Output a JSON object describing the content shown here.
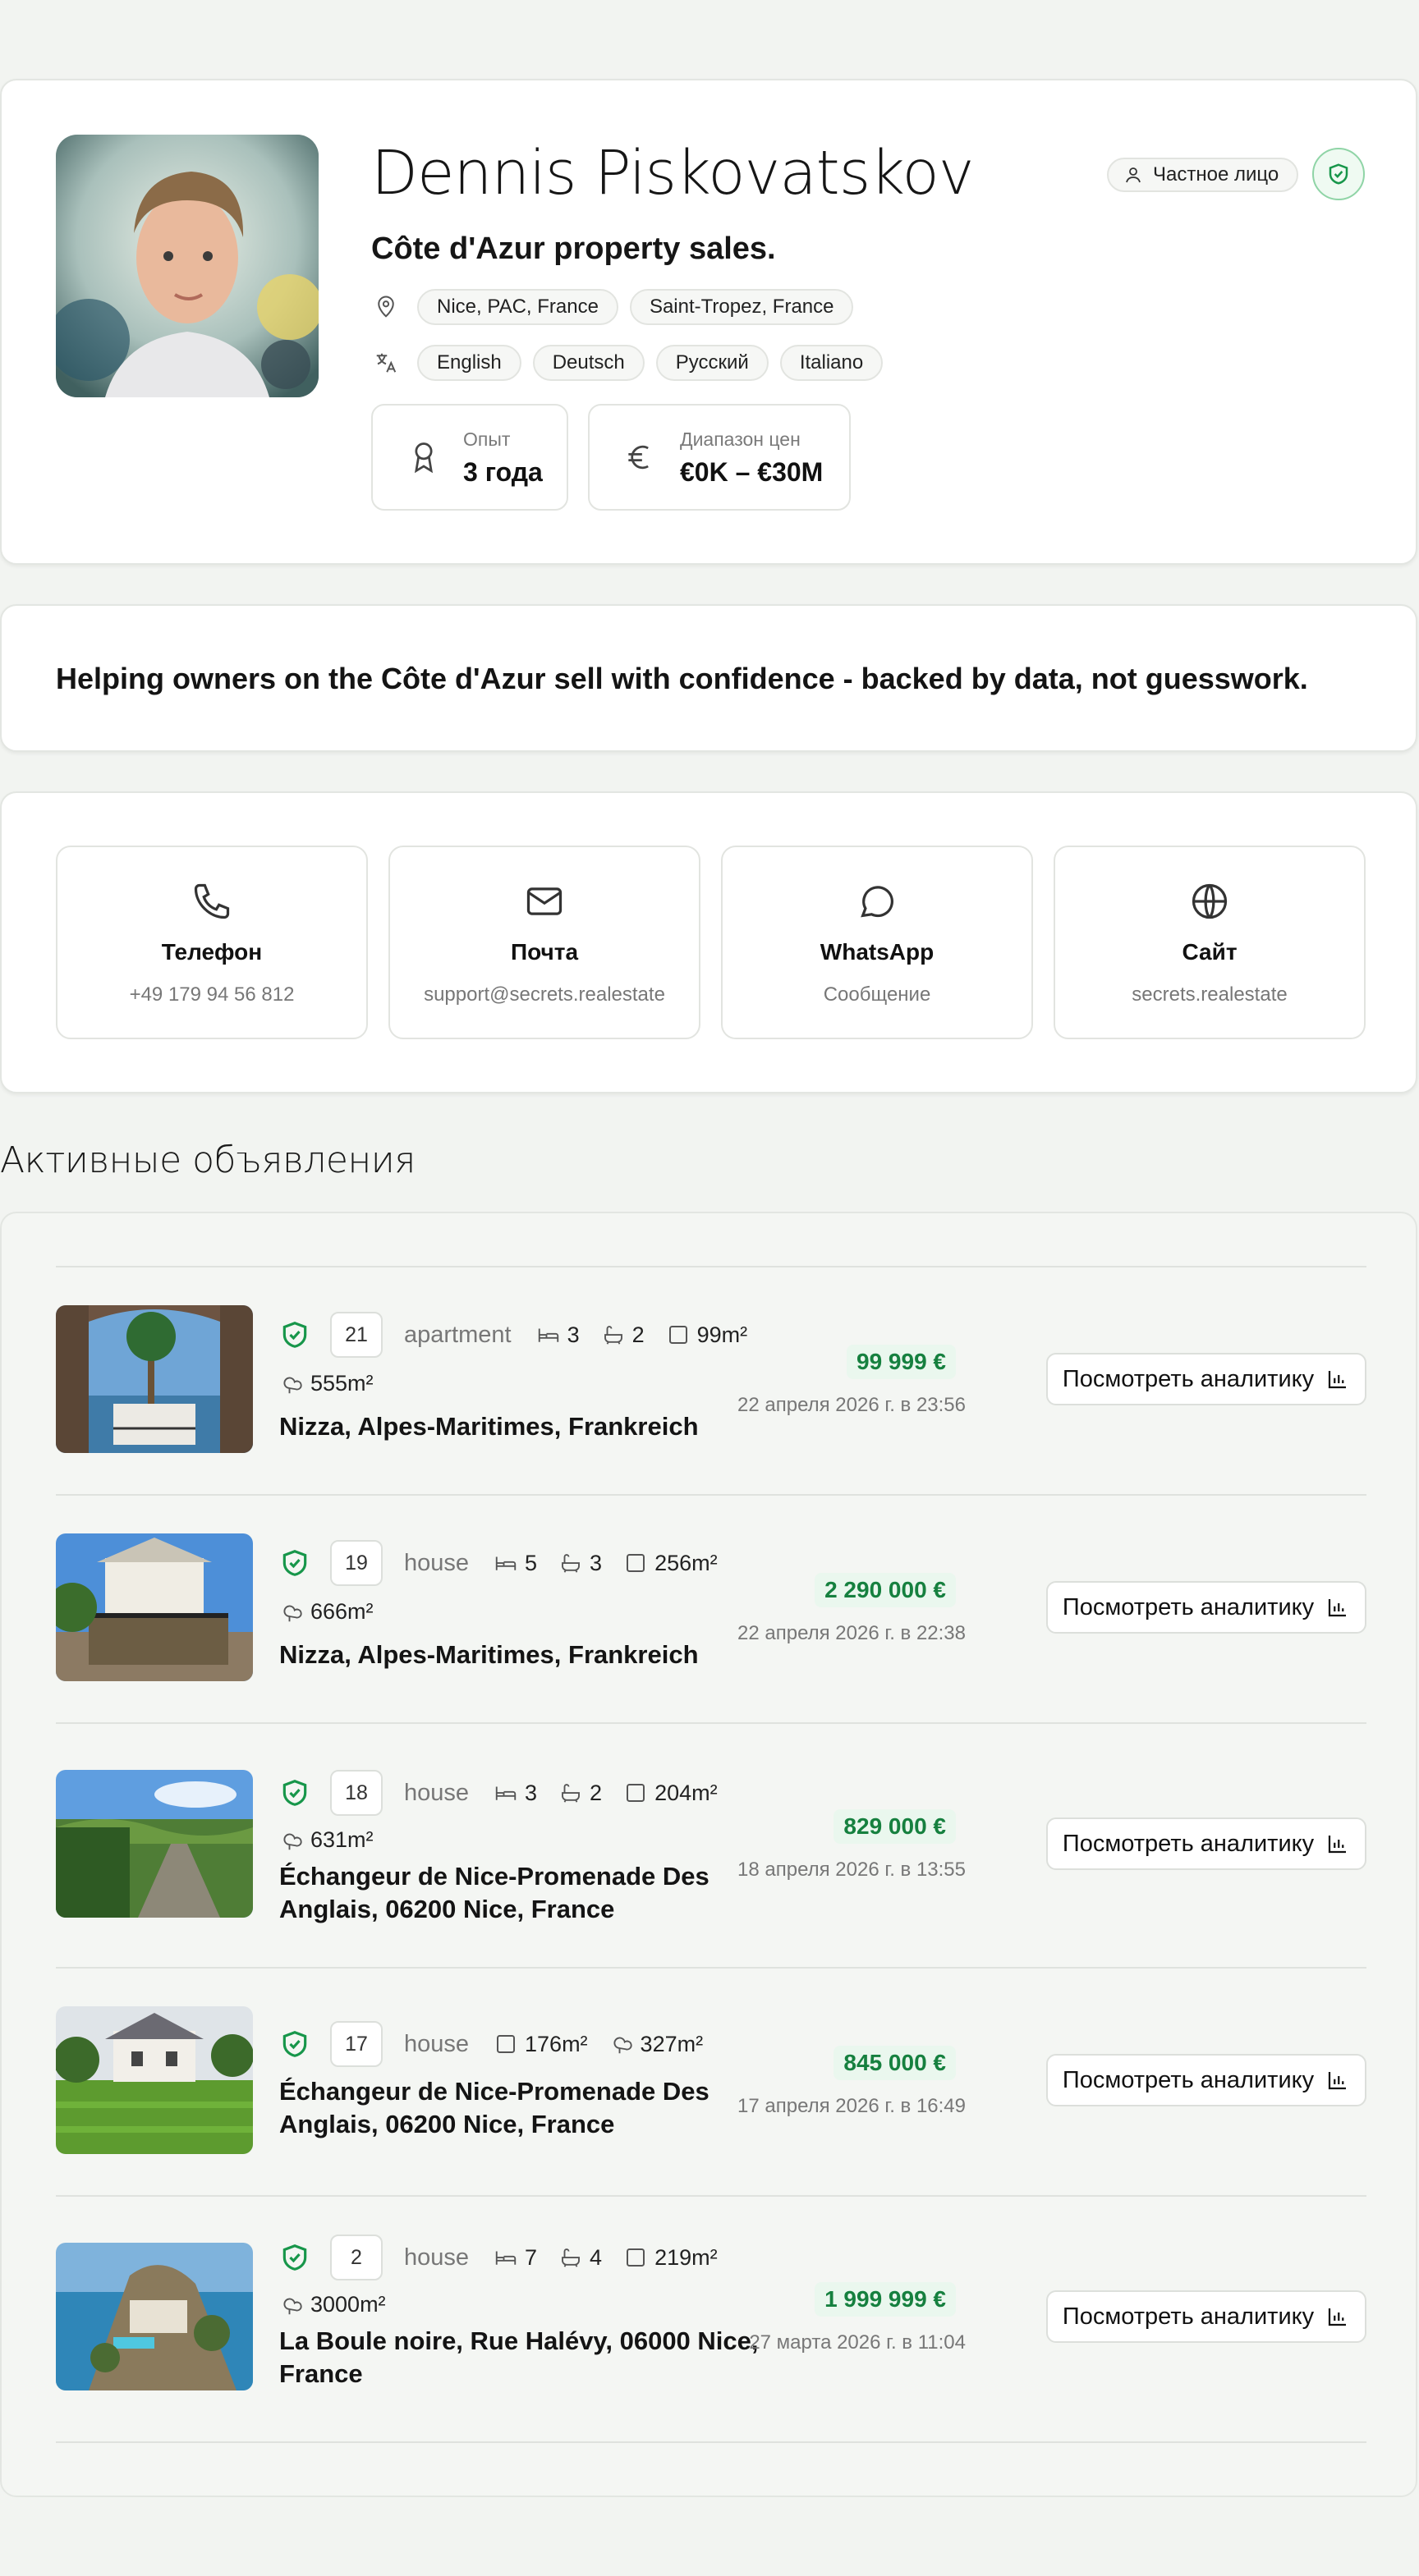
{
  "profile": {
    "name": "Dennis Piskovatskov",
    "tagline": "Côte d'Azur property sales.",
    "locations": [
      "Nice, PAC, France",
      "Saint-Tropez, France"
    ],
    "languages": [
      "English",
      "Deutsch",
      "Русский",
      "Italiano"
    ],
    "experience_label": "Опыт",
    "experience_value": "3 года",
    "price_range_label": "Диапазон цен",
    "price_range_value": "€0K – €30M",
    "badge_private": "Частное лицо",
    "accent_color": "#17964a"
  },
  "about": {
    "text": "Helping owners on the Côte d'Azur sell with confidence - backed by data, not guesswork."
  },
  "contacts": [
    {
      "title": "Телефон",
      "subtitle": "+49 179 94 56 812",
      "icon": "phone-icon"
    },
    {
      "title": "Почта",
      "subtitle": "support@secrets.realestate",
      "icon": "mail-icon"
    },
    {
      "title": "WhatsApp",
      "subtitle": "Сообщение",
      "icon": "chat-bubble-icon"
    },
    {
      "title": "Сайт",
      "subtitle": "secrets.realestate",
      "icon": "globe-icon"
    }
  ],
  "listings_section": {
    "title": "Активные объявления",
    "button_label": "Посмотреть аналитику"
  },
  "listings": [
    {
      "num": "21",
      "type": "apartment",
      "beds": "3",
      "baths": "2",
      "area": "99m²",
      "land": "555m²",
      "address": "Nizza, Alpes-Maritimes, Frankreich",
      "price": "99 999 €",
      "date": "22 апреля 2026 г. в 23:56"
    },
    {
      "num": "19",
      "type": "house",
      "beds": "5",
      "baths": "3",
      "area": "256m²",
      "land": "666m²",
      "address": "Nizza, Alpes-Maritimes, Frankreich",
      "price": "2 290 000 €",
      "date": "22 апреля 2026 г. в 22:38"
    },
    {
      "num": "18",
      "type": "house",
      "beds": "3",
      "baths": "2",
      "area": "204m²",
      "land": "631m²",
      "address": "Échangeur de Nice-Promenade Des Anglais, 06200 Nice, France",
      "price": "829 000 €",
      "date": "18 апреля 2026 г. в 13:55"
    },
    {
      "num": "17",
      "type": "house",
      "area": "176m²",
      "land": "327m²",
      "address": "Échangeur de Nice-Promenade Des Anglais, 06200 Nice, France",
      "price": "845 000 €",
      "date": "17 апреля 2026 г. в 16:49"
    },
    {
      "num": "2",
      "type": "house",
      "beds": "7",
      "baths": "4",
      "area": "219m²",
      "land": "3000m²",
      "address": "La Boule noire, Rue Halévy, 06000 Nice, France",
      "price": "1 999 999 €",
      "date": "27 марта 2026 г. в 11:04"
    }
  ]
}
